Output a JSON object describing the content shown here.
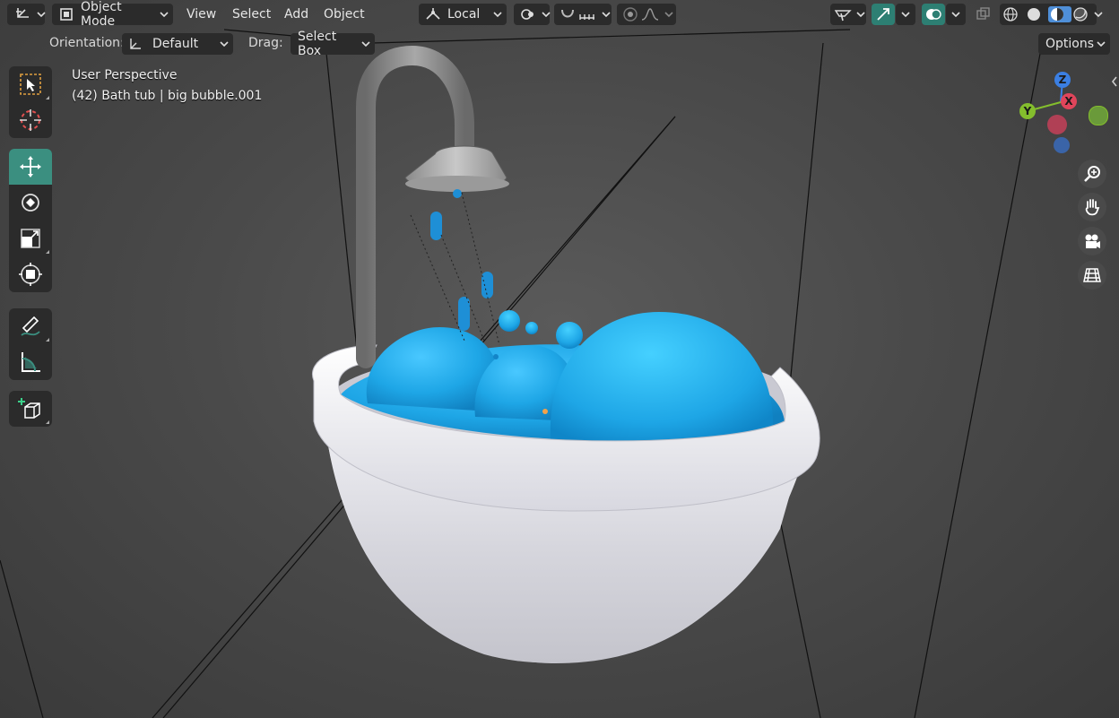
{
  "header": {
    "editor_type_icon": "grid-axes-icon",
    "mode": "Object Mode",
    "menus": [
      "View",
      "Select",
      "Add",
      "Object"
    ],
    "transform_pivot": "Local",
    "options_label": "Options"
  },
  "toolsettings": {
    "orientation_label": "Orientation:",
    "orientation_value": "Default",
    "drag_label": "Drag:",
    "drag_value": "Select Box"
  },
  "viewport": {
    "view_name": "User Perspective",
    "object_info": "(42) Bath tub | big bubble.001"
  },
  "gizmo": {
    "z": "Z",
    "x": "X",
    "y": "Y"
  },
  "colors": {
    "accent": "#3b8f80",
    "water": "#1ea6e6",
    "tub": "#e9e9ee",
    "axis_x": "#e0455b",
    "axis_y": "#84be2d",
    "axis_z": "#3b7fe3"
  },
  "toolbar": {
    "tools": [
      "select-box-icon",
      "cursor-icon",
      "move-icon",
      "rotate-icon",
      "scale-icon",
      "transform-icon",
      "annotate-icon",
      "measure-icon",
      "add-cube-icon"
    ],
    "active_tool": "move-icon"
  },
  "navigation": [
    "zoom-icon",
    "hand-pan-icon",
    "camera-icon",
    "ortho-grid-icon"
  ]
}
